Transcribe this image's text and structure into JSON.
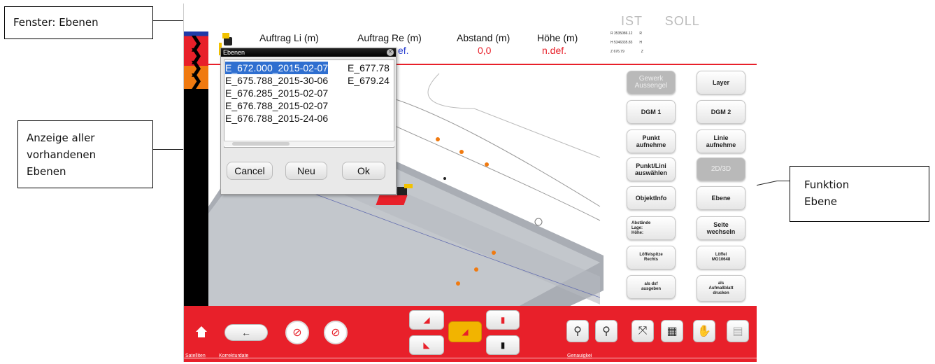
{
  "callouts": {
    "fenster": "Fenster: Ebenen",
    "anzeige_lines": [
      "Anzeige aller",
      "vorhandenen",
      "Ebenen"
    ],
    "funktion_lines": [
      "Funktion",
      "Ebene"
    ]
  },
  "header": {
    "col1": "Auftrag Li (m)",
    "col2": "Auftrag Re (m)",
    "col2_value": "ef.",
    "col3": "Abstand (m)",
    "col3_value": "0,0",
    "col4": "Höhe (m)",
    "col4_value": "n.def.",
    "ist": "IST",
    "soll": "SOLL",
    "coord_r": "R 3535086.12",
    "coord_r_tag": "R",
    "coord_h": "H 5346335.83",
    "coord_h_tag": "H",
    "coord_z": "Z 676.79",
    "coord_z_tag": "Z"
  },
  "dialog": {
    "title": "Ebenen",
    "items_col1": [
      "E_672.000_2015-02-07",
      "E_675.788_2015-30-06",
      "E_676.285_2015-02-07",
      "E_676.788_2015-02-07",
      "E_676.788_2015-24-06"
    ],
    "items_col2": [
      "E_677.78",
      "E_679.24"
    ],
    "selected_index": 0,
    "cancel": "Cancel",
    "neu": "Neu",
    "ok": "Ok"
  },
  "functions": {
    "gewerk_line1": "Gewerk",
    "gewerk_line2": "Aussengel",
    "layer": "Layer",
    "dgm1": "DGM 1",
    "dgm2": "DGM 2",
    "punkt_line1": "Punkt",
    "punkt_line2": "aufnehme",
    "linie_line1": "Linie",
    "linie_line2": "aufnehme",
    "punktlini_line1": "Punkt/Lini",
    "punktlini_line2": "auswählen",
    "d2d3": "2D/3D",
    "objektinfo": "ObjektInfo",
    "ebene": "Ebene",
    "abstaende_line1": "Abstände",
    "abstaende_line2": "Lage:",
    "abstaende_line3": "Höhe:",
    "seite_line1": "Seite",
    "seite_line2": "wechseln",
    "loeffelspitze_line1": "Löffelspitze",
    "loeffelspitze_line2": "Rechts",
    "loeffel_line1": "Löffel",
    "loeffel_line2": "MO10648",
    "dxf_line1": "als dxf",
    "dxf_line2": "ausgeben",
    "aufmass_line1": "als",
    "aufmass_line2": "Aufmaßblatt",
    "aufmass_line3": "drucken"
  },
  "bottom": {
    "satelliten": "Satelliten",
    "korrektur": "Korrekturdate",
    "genauigkeit": "Genauigkei"
  },
  "colors": {
    "brand_red": "#e8202a",
    "selection_blue": "#2f6fd0",
    "chevron_orange": "#f07a10"
  },
  "icons": [
    "home-icon",
    "back-arrow-icon",
    "no-satellite-icon",
    "no-correction-icon",
    "excavator-view-icon",
    "zoom-in-icon",
    "zoom-out-icon",
    "fit-extent-icon",
    "calculator-icon",
    "hand-pan-icon",
    "export-icon"
  ]
}
